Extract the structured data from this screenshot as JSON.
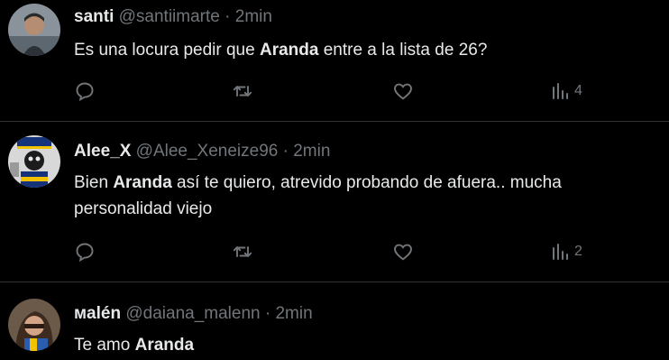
{
  "tweets": [
    {
      "name": "santi",
      "handle": "@santiimarte",
      "sep": " · ",
      "time": "2min",
      "text_before": "Es una locura pedir que ",
      "highlight": "Aranda",
      "text_after": " entre a la lista de 26?",
      "views": "4"
    },
    {
      "name": "Alee_X",
      "handle": "@Alee_Xeneize96",
      "sep": " · ",
      "time": "2min",
      "text_before": "Bien ",
      "highlight": "Aranda",
      "text_after": " así te quiero, atrevido probando de afuera.. mucha personalidad viejo",
      "views": "2"
    },
    {
      "name": "мalén",
      "handle": "@daiana_malenn",
      "sep": " · ",
      "time": "2min",
      "text_before": "Te amo ",
      "highlight": "Aranda",
      "text_after": ""
    }
  ],
  "colors": {
    "background": "#000000",
    "text": "#e7e9ea",
    "muted": "#71767b",
    "divider": "#2f3336"
  },
  "icons": [
    "reply-icon",
    "retweet-icon",
    "like-icon",
    "views-icon"
  ]
}
